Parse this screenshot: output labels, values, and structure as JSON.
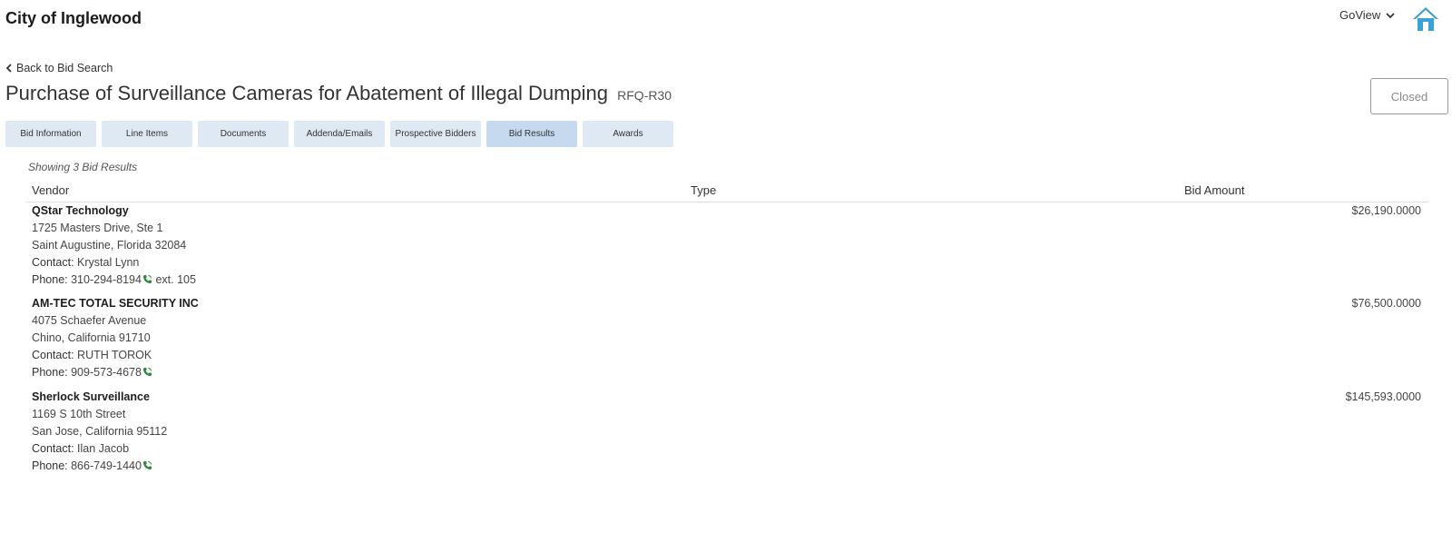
{
  "header": {
    "title": "City of Inglewood",
    "goview_label": "GoView"
  },
  "nav": {
    "back_label": "Back to Bid Search"
  },
  "bid": {
    "title": "Purchase of Surveillance Cameras for Abatement of Illegal Dumping",
    "code": "RFQ-R30",
    "status": "Closed"
  },
  "tabs": [
    {
      "label": "Bid Information"
    },
    {
      "label": "Line Items"
    },
    {
      "label": "Documents"
    },
    {
      "label": "Addenda/Emails"
    },
    {
      "label": "Prospective Bidders"
    },
    {
      "label": "Bid Results"
    },
    {
      "label": "Awards"
    }
  ],
  "results": {
    "showing_text": "Showing 3 Bid Results",
    "columns": {
      "vendor": "Vendor",
      "type": "Type",
      "amount": "Bid Amount"
    },
    "contact_label": "Contact:",
    "phone_label": "Phone:",
    "rows": [
      {
        "vendor": "QStar Technology",
        "address1": "1725 Masters Drive, Ste 1",
        "address2": "Saint Augustine, Florida 32084",
        "contact": "Krystal Lynn",
        "phone": "310-294-8194",
        "ext": "ext. 105",
        "amount": "$26,190.0000"
      },
      {
        "vendor": "AM-TEC TOTAL SECURITY INC",
        "address1": "4075 Schaefer Avenue",
        "address2": "Chino, California 91710",
        "contact": "RUTH TOROK",
        "phone": "909-573-4678",
        "ext": "",
        "amount": "$76,500.0000"
      },
      {
        "vendor": "Sherlock Surveillance",
        "address1": "1169 S 10th Street",
        "address2": "San Jose, California 95112",
        "contact": "Ilan Jacob",
        "phone": "866-749-1440",
        "ext": "",
        "amount": "$145,593.0000"
      }
    ]
  },
  "colors": {
    "tab_bg": "#dfe9f4",
    "tab_active_bg": "#c5d9ef",
    "phone_icon": "#2e8b3d",
    "home_icon": "#3aa0d8"
  }
}
